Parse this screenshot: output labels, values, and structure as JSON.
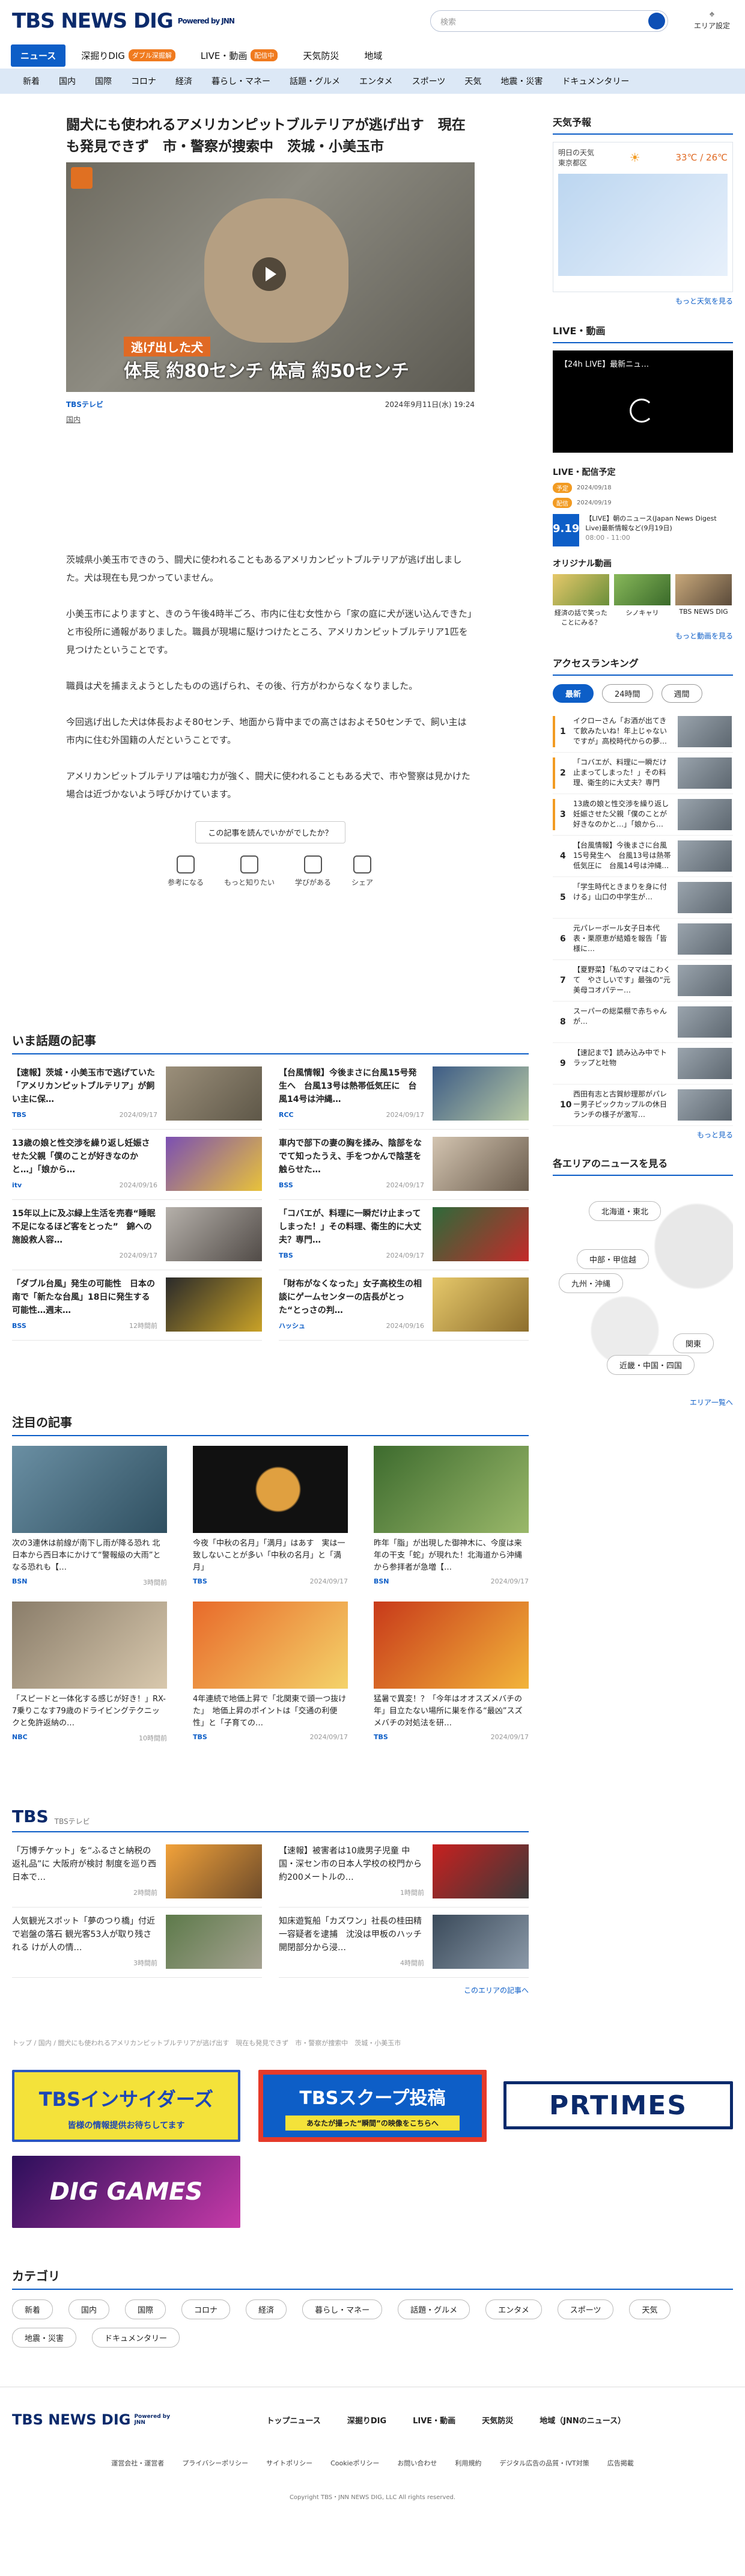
{
  "header": {
    "logo": "TBS NEWS DIG",
    "powered": "Powered by JNN",
    "search_placeholder": "検索",
    "area_label": "エリア設定"
  },
  "tabs": [
    {
      "label": "ニュース",
      "active": true
    },
    {
      "label": "深掘りDIG",
      "badge": "ダブル深掘解"
    },
    {
      "label": "LIVE・動画",
      "badge": "配信中"
    },
    {
      "label": "天気防災"
    },
    {
      "label": "地域"
    }
  ],
  "categories": [
    "新着",
    "国内",
    "国際",
    "コロナ",
    "経済",
    "暮らし・マネー",
    "話題・グルメ",
    "エンタメ",
    "スポーツ",
    "天気",
    "地震・災害",
    "ドキュメンタリー"
  ],
  "article": {
    "title": "闘犬にも使われるアメリカンピットブルテリアが逃げ出す　現在も発見できず　市・警察が捜索中　茨城・小美玉市",
    "caption1": "逃げ出した犬",
    "caption2": "体長 約80センチ  体高 約50センチ",
    "source": "TBSテレビ",
    "date": "2024年9月11日(水) 19:24",
    "tag": "国内",
    "paragraphs": [
      "茨城県小美玉市できのう、闘犬に使われることもあるアメリカンピットブルテリアが逃げ出しました。犬は現在も見つかっていません。",
      "小美玉市によりますと、きのう午後4時半ごろ、市内に住む女性から「家の庭に犬が迷い込んできた」と市役所に通報がありました。職員が現場に駆けつけたところ、アメリカンピットブルテリア1匹を見つけたということです。",
      "職員は犬を捕まえようとしたものの逃げられ、その後、行方がわからなくなりました。",
      "今回逃げ出した犬は体長およそ80センチ、地面から背中までの高さはおよそ50センチで、飼い主は市内に住む外国籍の人だということです。",
      "アメリカンピットブルテリアは噛む力が強く、闘犬に使われることもある犬で、市や警察は見かけた場合は近づかないよう呼びかけています。"
    ],
    "feedback_q": "この記事を読んでいかがでしたか？",
    "reactions": [
      "参考になる",
      "もっと知りたい",
      "学びがある",
      "シェア"
    ]
  },
  "trending": {
    "title": "いま話題の記事",
    "items": [
      {
        "t": "【速報】茨城・小美玉市で逃げていた「アメリカンピットブルテリア」が飼い主に保…",
        "s": "TBS",
        "d": "2024/09/17"
      },
      {
        "t": "【台風情報】今後まさに台風15号発生へ　台風13号は熱帯低気圧に　台風14号は沖縄…",
        "s": "RCC",
        "d": "2024/09/17"
      },
      {
        "t": "13歳の娘と性交渉を繰り返し妊娠させた父親「僕のことが好きなのかと…」「娘から…",
        "s": "itv",
        "d": "2024/09/16"
      },
      {
        "t": "車内で部下の妻の胸を揉み、陰部をなでて知ったうえ、手をつかんで陰茎を触らせた…",
        "s": "BSS",
        "d": "2024/09/17"
      },
      {
        "t": "15年以上に及ぶ緑上生活を売春“睡眠不足になるほど客をとった”　錦への施設救人容…",
        "s": "",
        "d": "2024/09/17"
      },
      {
        "t": "「コバエが、料理に一瞬だけ止まってしまった！」その料理、衛生的に大丈夫？専門…",
        "s": "TBS",
        "d": "2024/09/17"
      },
      {
        "t": "「ダブル台風」発生の可能性　日本の南で「新たな台風」18日に発生する可能性…週末…",
        "s": "BSS",
        "d": "12時間前"
      },
      {
        "t": "「財布がなくなった」女子高校生の相談にゲームセンターの店長がとった“とっさの判…",
        "s": "ハッシュ",
        "d": "2024/09/16"
      }
    ]
  },
  "featured": {
    "title": "注目の記事",
    "items": [
      {
        "t": "次の3連休は前線が南下し雨が降る恐れ 北日本から西日本にかけて“警報級の大雨”となる恐れも【…",
        "s": "BSN",
        "d": "3時間前"
      },
      {
        "t": "今夜「中秋の名月」「満月」はあす　実は一致しないことが多い「中秋の名月」と「満月」",
        "s": "TBS",
        "d": "2024/09/17"
      },
      {
        "t": "昨年「脂」が出現した御神木に、今度は来年の干支「蛇」が現れた！北海道から沖縄から参拝者が急増【…",
        "s": "BSN",
        "d": "2024/09/17"
      },
      {
        "t": "「スピードと一体化する感じが好き！」RX-7乗りこなす79歳のドライビングテクニックと免許返納の…",
        "s": "NBC",
        "d": "10時間前"
      },
      {
        "t": "4年連続で地価上昇で「北関東で頭一つ抜けた」　地価上昇のポイントは「交通の利便性」と「子育ての…",
        "s": "TBS",
        "d": "2024/09/17"
      },
      {
        "t": "猛暑で異変！？「今年はオオスズメバチの年」目立たない場所に巣を作る“最凶”スズメバチの対処法を研…",
        "s": "TBS",
        "d": "2024/09/17"
      }
    ]
  },
  "tbs": {
    "title": "TBS",
    "sub": "TBSテレビ",
    "items": [
      {
        "t": "「万博チケット」を“ふるさと納税の返礼品”に 大阪府が検討 制度を巡り西日本で…",
        "d": "2時間前"
      },
      {
        "t": "【速報】被害者は10歳男子児童 中国・深セン市の日本人学校の校門から約200メートルの…",
        "d": "1時間前"
      },
      {
        "t": "人気観光スポット「夢のつり橋」付近で岩盤の落石 観光客53人が取り残される けが人の情…",
        "d": "3時間前"
      },
      {
        "t": "知床遊覧船「カズワン」社長の桂田精一容疑者を逮捕　沈没は甲板のハッチ開閉部分から浸…",
        "d": "4時間前"
      }
    ],
    "more": "このエリアの記事へ"
  },
  "breadcrumb": "トップ / 国内 / 闘犬にも使われるアメリカンピットブルテリアが逃げ出す　現在も発見できず　市・警察が捜索中　茨城・小美玉市",
  "banners": {
    "insiders": "TBSインサイダーズ",
    "insiders_sub": "皆様の情報提供お待ちしてます",
    "scoop": "TBSスクープ投稿",
    "scoop_sub": "あなたが撮った“瞬間”の映像をこちらへ",
    "prtimes": "PRTIMES",
    "dig": "DIG GAMES"
  },
  "category_title": "カテゴリ",
  "category_list": [
    "新着",
    "国内",
    "国際",
    "コロナ",
    "経済",
    "暮らし・マネー",
    "話題・グルメ",
    "エンタメ",
    "スポーツ",
    "天気",
    "地震・災害",
    "ドキュメンタリー"
  ],
  "side": {
    "weather_title": "天気予報",
    "weather_day": "明日の天気",
    "weather_place": "東京都区",
    "weather_temp": "33℃ / 26℃",
    "weather_more": "もっと天気を見る",
    "live_title": "LIVE・動画",
    "live_video": "【24h LIVE】最新ニュ…",
    "schedule_title": "LIVE・配信予定",
    "schedule": [
      {
        "badge": "予定",
        "date": "2024/09/18"
      },
      {
        "badge": "配信",
        "date": "2024/09/19"
      }
    ],
    "live_item": "【LIVE】朝のニュース(Japan News Digest Live)最新情報など(9月19日)",
    "live_item_date": "9.19",
    "live_item_time": "08:00 - 11:00",
    "original_title": "オリジナル動画",
    "originals": [
      "経済の話で笑ったことにみる？",
      "シノキャリ",
      "TBS NEWS DIG"
    ],
    "originals_more": "もっと動画を見る",
    "ranking_title": "アクセスランキング",
    "ranking_tabs": [
      "最新",
      "24時間",
      "週間"
    ],
    "ranking": [
      "イクローさん「お酒が出てきて飲みたいね！年上じゃないですが」高校時代からの夢…",
      "「コバエが、料理に一瞬だけ止まってしまった！」その料理、衛生的に大丈夫？専門家…",
      "13歳の娘と性交渉を繰り返し妊娠させた父親「僕のことが好きなのかと…」「娘から…",
      "【台風情報】今後まさに台風15号発生へ　台風13号は熱帯低気圧に　台風14号は沖縄…",
      "「学生時代ときまりを身に付ける」山口の中学生が…",
      "元パレーボール女子日本代表・栗原恵が結婚を報告「皆様に…",
      "【夏野菜】「私のママはこわくて　やさしいです」最強の“元美母コオパテー…",
      "スーパーの総菜棚で赤ちゃんが…",
      "【速記まで】読み込み中でトラップと吐物",
      "西田有志と古賀紗理那がパレー男子ピックカップルの休日ランチの様子が激写…"
    ],
    "ranking_more": "もっと見る",
    "area_title": "各エリアのニュースを見る",
    "areas": [
      "北海道・東北",
      "中部・甲信越",
      "九州・沖縄",
      "関東",
      "近畿・中国・四国"
    ],
    "area_more": "エリア一覧へ"
  },
  "footer": {
    "links": [
      "トップニュース",
      "深掘りDIG",
      "LIVE・動画",
      "天気防災",
      "地域（JNNのニュース）"
    ],
    "small": [
      "運営会社・運営者",
      "プライバシーポリシー",
      "サイトポリシー",
      "Cookieポリシー",
      "お問い合わせ",
      "利用規約",
      "デジタル広告の品質・IVT対策",
      "広告掲載"
    ],
    "copyright": "Copyright TBS・JNN NEWS DIG, LLC All rights reserved."
  }
}
